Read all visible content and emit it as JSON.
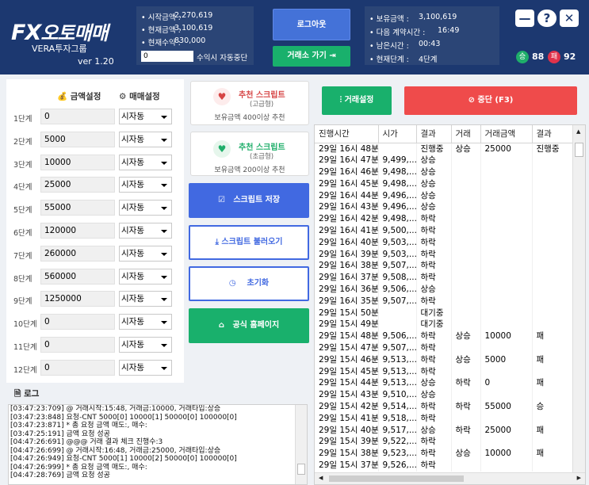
{
  "app": {
    "logo_fx": "FX",
    "logo_text": "오토매매",
    "company": "VERA투자그룹",
    "version": "ver 1.20"
  },
  "info_left": [
    {
      "label": "시작금액 :",
      "value": "2,270,619"
    },
    {
      "label": "현재금액 :",
      "value": "3,100,619"
    },
    {
      "label": "현재수익 :",
      "value": "830,000"
    }
  ],
  "profit_input": "0",
  "auto_stop_label": "수익시 자동중단",
  "logout_button": "로그아웃",
  "exchange_button": "거래소 가기",
  "info_right": [
    {
      "label": "보유금액 :",
      "value": "3,100,619"
    },
    {
      "label": "다음 계약시간 :",
      "value": "16:49"
    },
    {
      "label": "남은시간 :",
      "value": "00:43"
    },
    {
      "label": "현재단계 :",
      "value": "4단계"
    }
  ],
  "wins": {
    "badge": "승",
    "count": "88"
  },
  "losses": {
    "badge": "패",
    "count": "92"
  },
  "col_amount": "금액설정",
  "col_trade": "매매설정",
  "steps": [
    {
      "label": "1단계",
      "amount": "0",
      "mode": "시자동"
    },
    {
      "label": "2단계",
      "amount": "5000",
      "mode": "시자동"
    },
    {
      "label": "3단계",
      "amount": "10000",
      "mode": "시자동"
    },
    {
      "label": "4단계",
      "amount": "25000",
      "mode": "시자동"
    },
    {
      "label": "5단계",
      "amount": "55000",
      "mode": "시자동"
    },
    {
      "label": "6단계",
      "amount": "120000",
      "mode": "시자동"
    },
    {
      "label": "7단계",
      "amount": "260000",
      "mode": "시자동"
    },
    {
      "label": "8단계",
      "amount": "560000",
      "mode": "시자동"
    },
    {
      "label": "9단계",
      "amount": "1250000",
      "mode": "시자동"
    },
    {
      "label": "10단계",
      "amount": "0",
      "mode": "시자동"
    },
    {
      "label": "11단계",
      "amount": "0",
      "mode": "시자동"
    },
    {
      "label": "12단계",
      "amount": "0",
      "mode": "시자동"
    }
  ],
  "script_advanced": {
    "title": "추천 스크립트",
    "sub": "(고급형)",
    "note": "보유금액 400이상 추천"
  },
  "script_basic": {
    "title": "추천 스크립트",
    "sub": "(초급형)",
    "note": "보유금액 200이상 추천"
  },
  "save_script": "스크립트 저장",
  "load_script": "스크립트 불러오기",
  "reset": "초기화",
  "homepage": "공식 홈페이지",
  "trade_settings": "거래설정",
  "stop_button": "중단 (F3)",
  "table": {
    "headers": [
      "진행시간",
      "시가",
      "결과",
      "거래",
      "거래금액",
      "결과"
    ],
    "rows": [
      [
        "29일 16시 48분",
        "",
        "진행중",
        "상승",
        "25000",
        "진행중"
      ],
      [
        "29일 16시 47분",
        "9,499,...",
        "상승",
        "",
        "",
        ""
      ],
      [
        "29일 16시 46분",
        "9,498,...",
        "상승",
        "",
        "",
        ""
      ],
      [
        "29일 16시 45분",
        "9,498,...",
        "상승",
        "",
        "",
        ""
      ],
      [
        "29일 16시 44분",
        "9,496,...",
        "상승",
        "",
        "",
        ""
      ],
      [
        "29일 16시 43분",
        "9,496,...",
        "상승",
        "",
        "",
        ""
      ],
      [
        "29일 16시 42분",
        "9,498,...",
        "하락",
        "",
        "",
        ""
      ],
      [
        "29일 16시 41분",
        "9,500,...",
        "하락",
        "",
        "",
        ""
      ],
      [
        "29일 16시 40분",
        "9,503,...",
        "하락",
        "",
        "",
        ""
      ],
      [
        "29일 16시 39분",
        "9,503,...",
        "하락",
        "",
        "",
        ""
      ],
      [
        "29일 16시 38분",
        "9,507,...",
        "하락",
        "",
        "",
        ""
      ],
      [
        "29일 16시 37분",
        "9,508,...",
        "하락",
        "",
        "",
        ""
      ],
      [
        "29일 16시 36분",
        "9,506,...",
        "상승",
        "",
        "",
        ""
      ],
      [
        "29일 16시 35분",
        "9,507,...",
        "하락",
        "",
        "",
        ""
      ],
      [
        "29일 15시 50분",
        "",
        "대기중",
        "",
        "",
        ""
      ],
      [
        "29일 15시 49분",
        "",
        "대기중",
        "",
        "",
        ""
      ],
      [
        "29일 15시 48분",
        "9,506,...",
        "하락",
        "상승",
        "10000",
        "패"
      ],
      [
        "29일 15시 47분",
        "9,507,...",
        "하락",
        "",
        "",
        ""
      ],
      [
        "29일 15시 46분",
        "9,513,...",
        "하락",
        "상승",
        "5000",
        "패"
      ],
      [
        "29일 15시 45분",
        "9,513,...",
        "하락",
        "",
        "",
        ""
      ],
      [
        "29일 15시 44분",
        "9,513,...",
        "상승",
        "하락",
        "0",
        "패"
      ],
      [
        "29일 15시 43분",
        "9,510,...",
        "상승",
        "",
        "",
        ""
      ],
      [
        "29일 15시 42분",
        "9,514,...",
        "하락",
        "하락",
        "55000",
        "승"
      ],
      [
        "29일 15시 41분",
        "9,518,...",
        "하락",
        "",
        "",
        ""
      ],
      [
        "29일 15시 40분",
        "9,517,...",
        "상승",
        "하락",
        "25000",
        "패"
      ],
      [
        "29일 15시 39분",
        "9,522,...",
        "하락",
        "",
        "",
        ""
      ],
      [
        "29일 15시 38분",
        "9,523,...",
        "하락",
        "상승",
        "10000",
        "패"
      ],
      [
        "29일 15시 37분",
        "9,526,...",
        "하락",
        "",
        "",
        ""
      ]
    ]
  },
  "log_title": "로그",
  "log_lines": [
    "[03:47:23:709] @ 거래시작:15:48, 거래금:10000, 거래타입:상승",
    "[03:47:23:848] 요청-CNT 5000[0] 10000[1] 50000[0] 100000[0]",
    "[03:47:23:871] * 총 요청 금액 매도:, 매수:",
    "[03:47:25:191] 금액 요청 성공",
    "[04:47:26:691] @@@ 거래 결과 체크 진행수:3",
    "[04:47:26:699] @ 거래시작:16:48, 거래금:25000, 거래타입:상승",
    "[04:47:26:949] 요청-CNT 5000[1] 10000[2] 50000[0] 100000[0]",
    "[04:47:26:999] * 총 요청 금액 매도:, 매수:",
    "[04:47:28:769] 금액 요청 성공"
  ]
}
